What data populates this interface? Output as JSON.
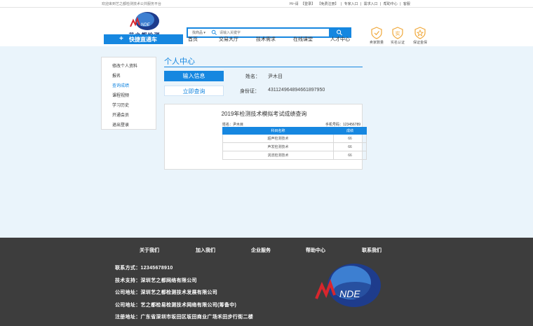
{
  "topbar": {
    "welcome": "欢迎来到艺之都检测技术公共服务平台",
    "links": [
      "Hi~请",
      "【登录】",
      "【免费注册】",
      "|",
      "专家入口",
      "|",
      "需求入口",
      "|",
      "帮助中心",
      "|",
      "客服"
    ]
  },
  "header": {
    "logo_text": "艺之都检测",
    "logo_mark": "NDE",
    "quick_plus": "+",
    "quick_label": "快捷直通车",
    "search": {
      "scope": "找商品 ▾",
      "placeholder": "请输入关键字"
    },
    "nav": [
      "首页",
      "交易大厅",
      "技术需求",
      "在线课堂",
      "人才中心"
    ],
    "badges": [
      {
        "icon": "shield-icon",
        "label": "卖家数量"
      },
      {
        "icon": "chat-icon",
        "label": "实名认证"
      },
      {
        "icon": "star-icon",
        "label": "保证金保"
      }
    ]
  },
  "sidebar": {
    "items": [
      "修改个人资料",
      "报名",
      "查询成绩",
      "课程视频",
      "学习历史",
      "开通会员",
      "退出登录"
    ],
    "active_index": 2
  },
  "main": {
    "title": "个人中心",
    "tab_input": "输入信息",
    "tab_query": "立即查询",
    "name_label": "姓名：",
    "name_value": "尹木目",
    "id_label": "身份证：",
    "id_value": "431124964894661897950"
  },
  "result": {
    "title": "2019年检测技术模拟考试成绩查询",
    "name_info": "姓名：尹木目",
    "phone_info": "手机号码：123456789",
    "headers": [
      "科目名称",
      "成绩"
    ],
    "rows": [
      [
        "超声检测技术",
        "66"
      ],
      [
        "声发检测技术",
        "66"
      ],
      [
        "涡流检测技术",
        "66"
      ]
    ]
  },
  "footer": {
    "nav": [
      "关于我们",
      "加入我们",
      "企业服务",
      "帮助中心",
      "联系我们"
    ],
    "lines": [
      "联系方式：12345678910",
      "技术支持：深圳艺之都网络有限公司",
      "公司地址：深圳艺之都检测技术发展有限公司",
      "公司地址：艺之都检易检测技术网络有限公司(筹备中)",
      "注册地址：广东省深圳市坂田区坂田商业广场禾田步行街二楼"
    ],
    "logo_mark": "NDE"
  },
  "colors": {
    "accent": "#1687e0",
    "footer_bg": "#3d3d3d",
    "page_bg": "#eaf4fb"
  }
}
